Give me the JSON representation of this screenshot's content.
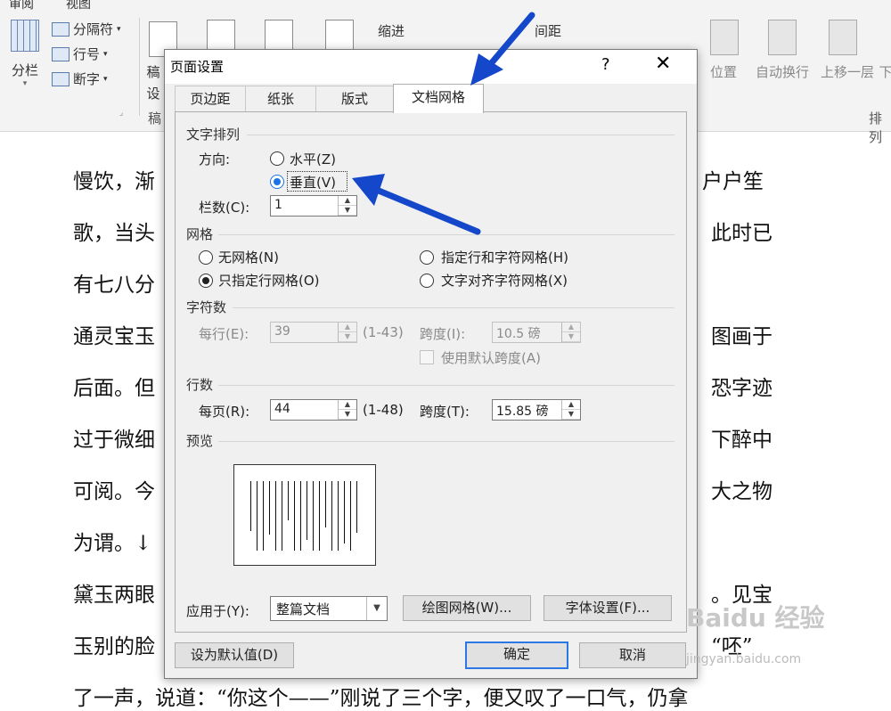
{
  "ribbon": {
    "tabs": [
      "审阅",
      "视图"
    ],
    "columns_label": "分栏",
    "breaks_label": "分隔符",
    "line_numbers_label": "行号",
    "hyphenation_label": "断字",
    "manuscript_label_1": "稿",
    "manuscript_label_2": "设",
    "manuscript_label_3": "稿",
    "indent_label": "缩进",
    "spacing_label": "间距",
    "position_label": "位置",
    "wrap_text_label": "自动换行",
    "bring_forward_label": "上移一层",
    "next_label": "下",
    "arrange_label": "排列"
  },
  "document": {
    "lines_left": [
      "慢饮，渐",
      "歌，当头",
      "有七八分",
      "通灵宝玉",
      "后面。但",
      "过于微细",
      "可阅。今",
      "为谓。↓",
      "黛玉两眼",
      "玉别的脸",
      "了一声，说道：“你这个——”刚说了三个字，便又叹了一口气，仍拿"
    ],
    "lines_right": [
      "户户笙",
      "此时已",
      "",
      "图画于",
      "恐字迹",
      "下醉中",
      "大之物",
      "",
      "。见宝",
      "“呸”"
    ]
  },
  "dialog": {
    "title": "页面设置",
    "help": "?",
    "close": "✕",
    "tabs": [
      "页边距",
      "纸张",
      "版式",
      "文档网格"
    ],
    "text_direction_section": "文字排列",
    "direction_label": "方向:",
    "horizontal": "水平(Z)",
    "vertical": "垂直(V)",
    "columns_label": "栏数(C):",
    "columns_value": "1",
    "grid_section": "网格",
    "no_grid": "无网格(N)",
    "line_char_grid": "指定行和字符网格(H)",
    "line_grid_only": "只指定行网格(O)",
    "align_char_grid": "文字对齐字符网格(X)",
    "chars_section": "字符数",
    "per_line_label": "每行(E):",
    "per_line_value": "39",
    "per_line_range": "(1-43)",
    "pitch_label_1": "跨度(I):",
    "pitch_value_1": "10.5 磅",
    "use_default_pitch": "使用默认跨度(A)",
    "lines_section": "行数",
    "per_page_label": "每页(R):",
    "per_page_value": "44",
    "per_page_range": "(1-48)",
    "pitch_label_2": "跨度(T):",
    "pitch_value_2": "15.85 磅",
    "preview_section": "预览",
    "apply_to_label": "应用于(Y):",
    "apply_to_value": "整篇文档",
    "draw_grid_button": "绘图网格(W)...",
    "font_settings_button": "字体设置(F)...",
    "set_default_button": "设为默认值(D)",
    "ok_button": "确定",
    "cancel_button": "取消"
  },
  "watermark": {
    "text": "Baidu 经验",
    "url": "jingyan.baidu.com"
  },
  "colors": {
    "annotation_arrow": "#1447c9",
    "accent": "#2b78e4"
  }
}
